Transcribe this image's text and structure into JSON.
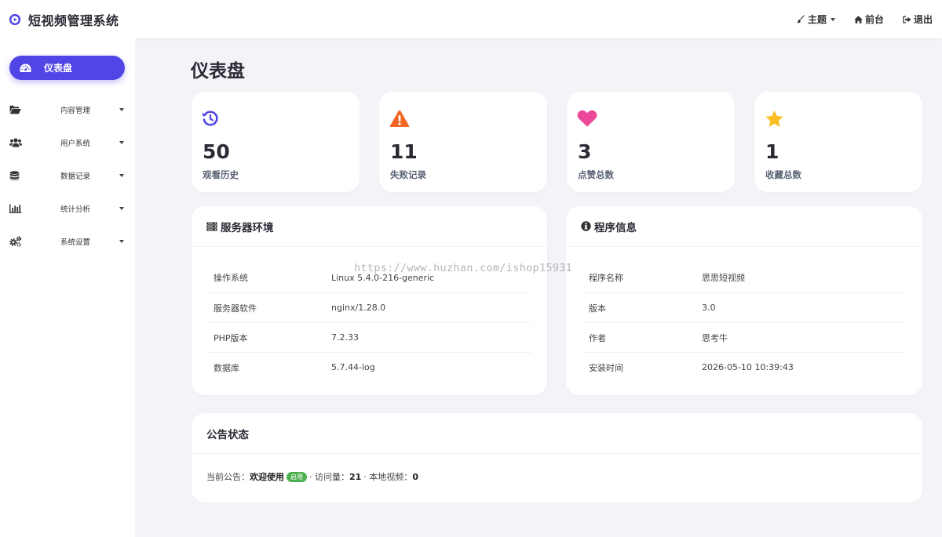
{
  "app": {
    "title": "短视频管理系统",
    "top_actions": [
      {
        "label": "主题",
        "icon": "brush-icon",
        "has_caret": true
      },
      {
        "label": "前台",
        "icon": "home-icon"
      },
      {
        "label": "退出",
        "icon": "logout-icon"
      }
    ]
  },
  "sidebar": {
    "active": {
      "label": "仪表盘",
      "icon": "dashboard-icon"
    },
    "items": [
      {
        "label": "内容管理",
        "icon": "folder-open-icon"
      },
      {
        "label": "用户系统",
        "icon": "users-icon"
      },
      {
        "label": "数据记录",
        "icon": "database-icon"
      },
      {
        "label": "统计分析",
        "icon": "bar-chart-icon"
      },
      {
        "label": "系统设置",
        "icon": "gears-icon"
      }
    ]
  },
  "page_title": "仪表盘",
  "stats": [
    {
      "value": "50",
      "label": "观看历史",
      "icon": "history-icon",
      "color": "#4f46e5"
    },
    {
      "value": "11",
      "label": "失败记录",
      "icon": "warning-icon",
      "color": "#f26522"
    },
    {
      "value": "3",
      "label": "点赞总数",
      "icon": "heart-icon",
      "color": "#ec4899"
    },
    {
      "value": "1",
      "label": "收藏总数",
      "icon": "star-icon",
      "color": "#fbbf24"
    }
  ],
  "server_panel": {
    "title": "服务器环境",
    "icon": "server-icon",
    "rows": [
      {
        "key": "操作系统",
        "value": "Linux 5.4.0-216-generic"
      },
      {
        "key": "服务器软件",
        "value": "nginx/1.28.0"
      },
      {
        "key": "PHP版本",
        "value": "7.2.33"
      },
      {
        "key": "数据库",
        "value": "5.7.44-log"
      }
    ]
  },
  "program_panel": {
    "title": "程序信息",
    "icon": "info-circle-icon",
    "rows": [
      {
        "key": "程序名称",
        "value": "思思短视频"
      },
      {
        "key": "版本",
        "value": "3.0"
      },
      {
        "key": "作者",
        "value": "思考牛"
      },
      {
        "key": "安装时间",
        "value": "2026-05-10 10:39:43"
      }
    ]
  },
  "notice_panel": {
    "title": "公告状态",
    "current_label": "当前公告：",
    "current_value": "欢迎使用",
    "badge": "启用",
    "visits_label": "· 访问量：",
    "visits_value": "21",
    "local_label": "· 本地视频：",
    "local_value": "0"
  },
  "watermark": "https://www.huzhan.com/ishop15931",
  "colors": {
    "accent": "#5145e6",
    "badge": "#4caf50"
  }
}
